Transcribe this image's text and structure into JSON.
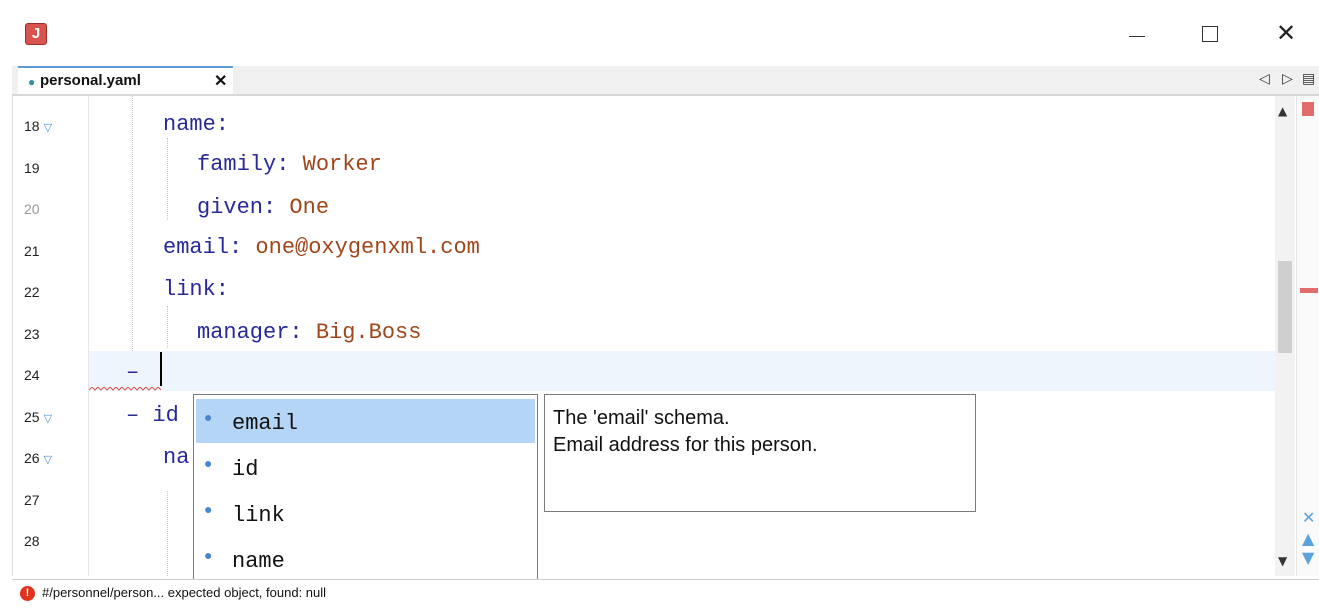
{
  "window": {
    "app_icon_letter": "J",
    "minimize_icon": "minimize-icon",
    "maximize_icon": "maximize-icon",
    "close_glyph": "✕"
  },
  "tabs": {
    "active_label": "personal.yaml",
    "close_glyph": "✕",
    "nav_left_glyph": "◁",
    "nav_right_glyph": "▷",
    "menu_glyph": "▤"
  },
  "editor": {
    "lines": [
      {
        "number": "18",
        "fold": true
      },
      {
        "number": "19",
        "fold": false
      },
      {
        "number": "20",
        "fold": false
      },
      {
        "number": "21",
        "fold": false
      },
      {
        "number": "22",
        "fold": false
      },
      {
        "number": "23",
        "fold": false
      },
      {
        "number": "24",
        "fold": false
      },
      {
        "number": "25",
        "fold": true
      },
      {
        "number": "26",
        "fold": true
      },
      {
        "number": "27",
        "fold": false
      },
      {
        "number": "28",
        "fold": false
      }
    ],
    "code": {
      "l18_key": "name:",
      "l19_key": "family:",
      "l19_val": "Worker",
      "l20_key": "given:",
      "l20_val": "One",
      "l21_key": "email:",
      "l21_val": "one@oxygenxml.com",
      "l22_key": "link:",
      "l23_key": "manager:",
      "l23_val": "Big.Boss",
      "l24_dash": "–",
      "l25_dash": "–",
      "l25_partial": "id",
      "l26_partial": "na"
    },
    "colors": {
      "key": "#28289a",
      "value": "#a0461a",
      "error": "#e06c6c",
      "selection": "#b5d5f7"
    }
  },
  "completion": {
    "items": [
      {
        "label": "email",
        "selected": true
      },
      {
        "label": "id",
        "selected": false
      },
      {
        "label": "link",
        "selected": false
      },
      {
        "label": "name",
        "selected": false
      }
    ],
    "doc_line1": "The 'email' schema.",
    "doc_line2": "Email address for this person."
  },
  "status": {
    "error_icon": "error-icon",
    "message": "#/personnel/person... expected object, found: null"
  }
}
